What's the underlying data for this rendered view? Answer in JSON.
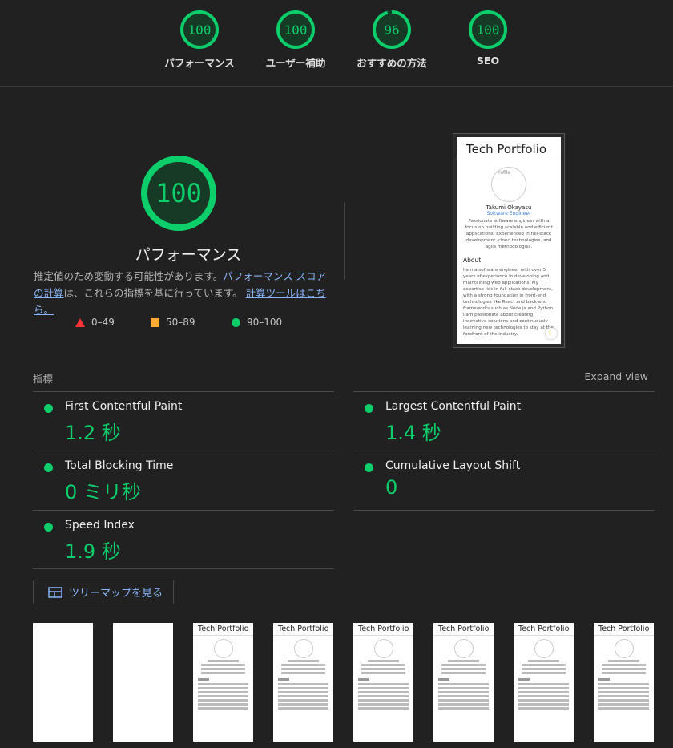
{
  "top_gauges": [
    {
      "label": "パフォーマンス",
      "score": "100",
      "value": 100
    },
    {
      "label": "ユーザー補助",
      "score": "100",
      "value": 100
    },
    {
      "label": "おすすめの方法",
      "score": "96",
      "value": 96
    },
    {
      "label": "SEO",
      "score": "100",
      "value": 100
    }
  ],
  "main": {
    "score": "100",
    "value": 100,
    "title": "パフォーマンス",
    "desc_prefix": "推定値のため変動する可能性があります。",
    "desc_link1": "パフォーマンス スコアの計算",
    "desc_middle": "は、これらの指標を基に行っています。",
    "desc_link2": "計算ツールはこちら。",
    "legend": [
      {
        "range": "0–49",
        "shape": "triangle",
        "color": "#ff3333"
      },
      {
        "range": "50–89",
        "shape": "square",
        "color": "#ffaa33"
      },
      {
        "range": "90–100",
        "shape": "circle",
        "color": "#0cce6b"
      }
    ]
  },
  "screenshot": {
    "site_title": "Tech Portfolio",
    "avatar_alt": "rofile",
    "name": "Takumi Okayasu",
    "role": "Software Engineer",
    "bio": "Passionate software engineer with a focus on building scalable and efficient applications. Experienced in full-stack development, cloud technologies, and agile methodologies.",
    "about_heading": "About",
    "about_text": "I am a software engineer with over 5 years of experience in developing and maintaining web applications. My expertise lies in full-stack development, with a strong foundation in front-end technologies like React and back-end frameworks such as Node.js and Python. I am passionate about creating innovative solutions and continuously learning new technologies to stay at the forefront of the industry.",
    "theme_icon": "☾"
  },
  "metrics": {
    "heading": "指標",
    "expand_label": "Expand view",
    "items": [
      {
        "name": "First Contentful Paint",
        "value": "1.2 秒"
      },
      {
        "name": "Largest Contentful Paint",
        "value": "1.4 秒"
      },
      {
        "name": "Total Blocking Time",
        "value": "0 ミリ秒"
      },
      {
        "name": "Cumulative Layout Shift",
        "value": "0"
      },
      {
        "name": "Speed Index",
        "value": "1.9 秒"
      }
    ],
    "status_color": "#0cce6b"
  },
  "treemap_button": {
    "label": "ツリーマップを見る",
    "icon": "treemap-icon"
  },
  "filmstrip": {
    "frame_title": "Tech Portfolio",
    "frames": [
      "blank",
      "blank",
      "loaded",
      "loaded",
      "loaded",
      "loaded",
      "loaded",
      "loaded"
    ]
  }
}
